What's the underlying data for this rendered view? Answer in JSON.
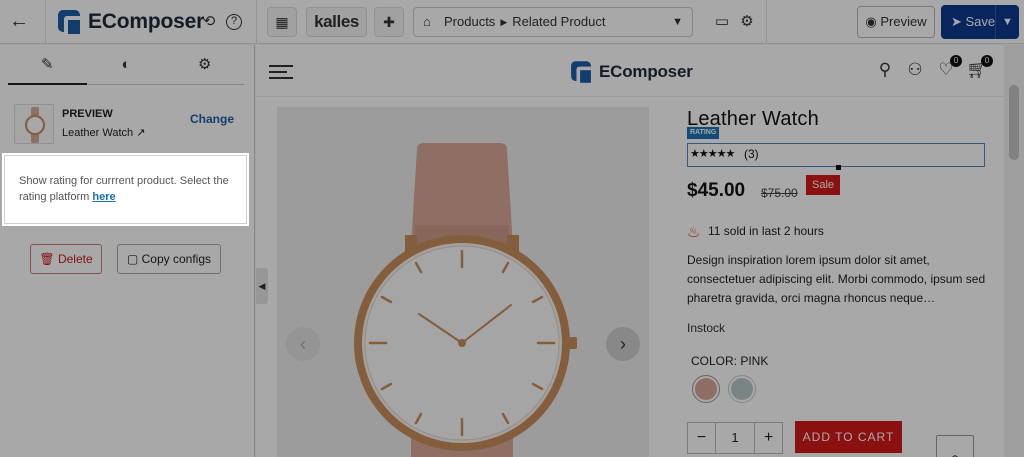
{
  "topbar": {
    "brand": "EComposer",
    "theme_button": "kalles",
    "page_selector": {
      "type": "Products",
      "page": "Related Product"
    },
    "preview_label": "Preview",
    "save_label": "Save"
  },
  "left_panel": {
    "tabs": [
      "pencil-icon",
      "palette-icon",
      "gear-icon"
    ],
    "product": {
      "label": "PREVIEW",
      "name": "Leather Watch",
      "change_label": "Change"
    },
    "info": {
      "text": "Show rating for currrent product. Select the rating platform ",
      "link": "here"
    },
    "delete_label": "Delete",
    "copy_label": "Copy configs"
  },
  "canvas": {
    "store_brand": "EComposer",
    "wishlist_count": "0",
    "cart_count": "0",
    "product": {
      "title": "Leather Watch",
      "rating_tag": "RATING",
      "stars": "★★★★★",
      "review_count": "(3)",
      "price": "$45.00",
      "compare_price": "$75.00",
      "sale_label": "Sale",
      "sold_text": "11 sold in last 2 hours",
      "description": "Design inspiration lorem ipsum dolor sit amet, consectetuer adipiscing elit. Morbi commodo, ipsum sed pharetra gravida, orci magna rhoncus neque…",
      "stock": "Instock",
      "color_label": "COLOR: PINK",
      "swatch_colors": [
        "#d8a797",
        "#b9c8c8"
      ],
      "quantity": "1",
      "cart_label": "ADD TO CART"
    }
  },
  "colors": {
    "accent": "#0d3a8e",
    "sale": "#d31a1a",
    "link": "#1d5fa8"
  }
}
